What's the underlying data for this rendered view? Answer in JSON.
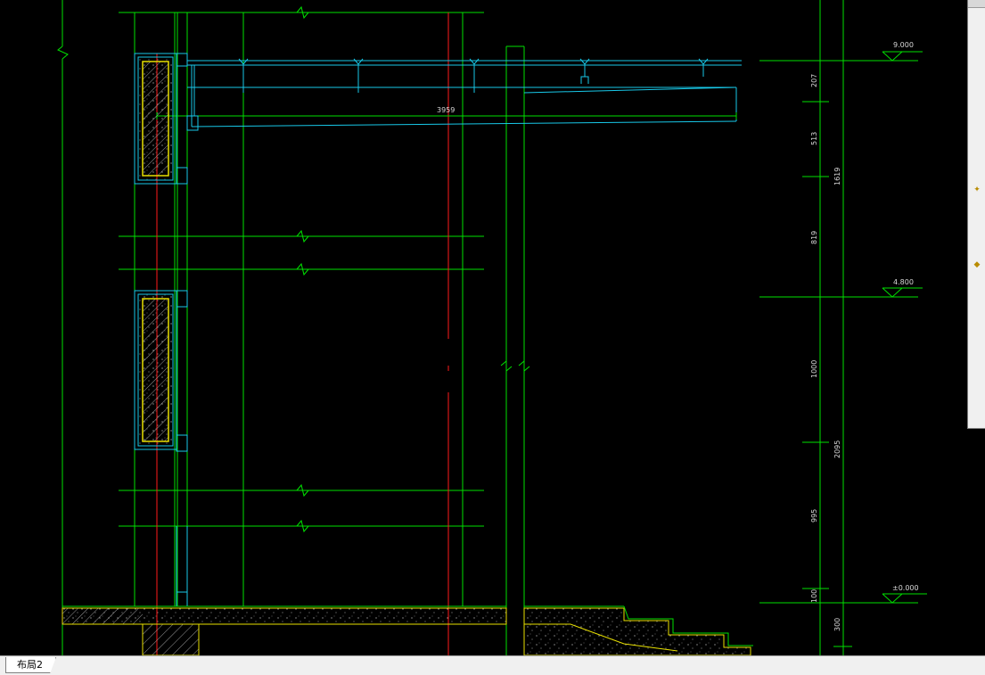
{
  "drawing": {
    "elevation_labels": {
      "top": "9.000",
      "middle": "4.800",
      "ground": "±0.000"
    },
    "beam_span_label": "3959",
    "dimensions_inner": [
      "207",
      "513",
      "819",
      "1000",
      "995",
      "100"
    ],
    "dimensions_outer": [
      "1619",
      "2095",
      "300"
    ]
  },
  "layout_tabs": [
    {
      "label": "布局2"
    }
  ],
  "colors": {
    "line_green": "#00e000",
    "line_cyan": "#18c8e8",
    "line_red": "#ff1a1a",
    "line_yellow": "#e8e000",
    "background": "#000000"
  }
}
